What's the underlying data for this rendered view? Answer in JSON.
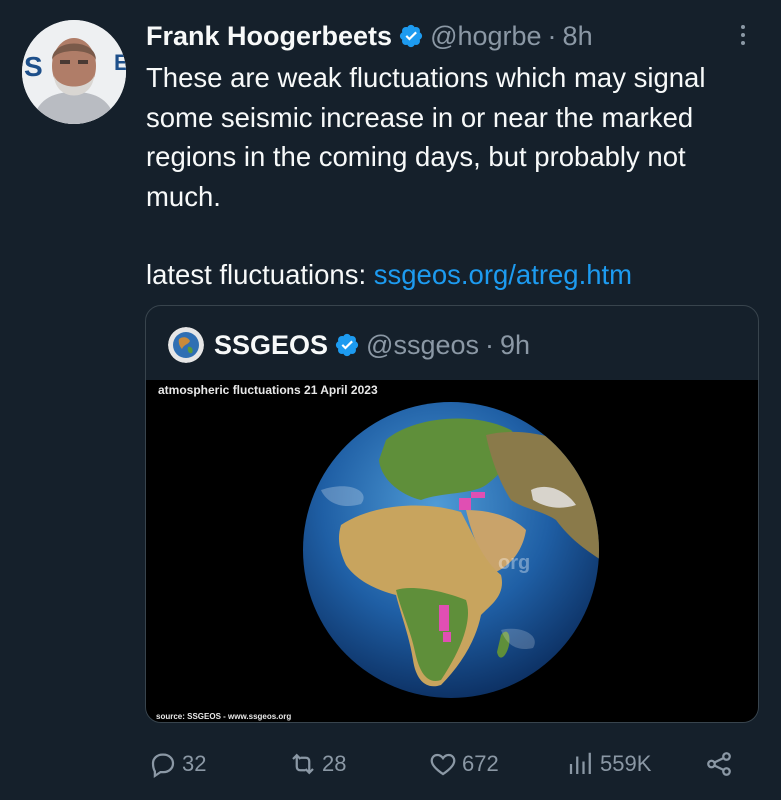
{
  "tweet": {
    "author_name": "Frank Hoogerbeets",
    "handle": "@hogrbe",
    "separator": "·",
    "time": "8h",
    "text_paragraph_1": "These are weak fluctuations which may signal some seismic increase in or near the marked regions in the coming days, but probably not much.",
    "text_paragraph_2_prefix": "latest fluctuations: ",
    "link_text": "ssgeos.org/atreg.htm"
  },
  "quoted": {
    "author_name": "SSGEOS",
    "handle": "@ssgeos",
    "separator": "·",
    "time": "9h",
    "media_title": "atmospheric fluctuations 21 April 2023",
    "media_watermark": "org",
    "media_source": "source: SSGEOS - www.ssgeos.org"
  },
  "actions": {
    "replies": "32",
    "reposts": "28",
    "likes": "672",
    "views": "559K"
  },
  "icons": {
    "more": "more-icon",
    "verified": "verified-badge-icon",
    "reply": "reply-icon",
    "repost": "repost-icon",
    "like": "like-icon",
    "views": "views-icon",
    "share": "share-icon"
  },
  "colors": {
    "background": "#15202b",
    "link": "#1d9bf0",
    "muted": "#8b98a5",
    "verified": "#1d9bf0",
    "border": "#38444d"
  }
}
